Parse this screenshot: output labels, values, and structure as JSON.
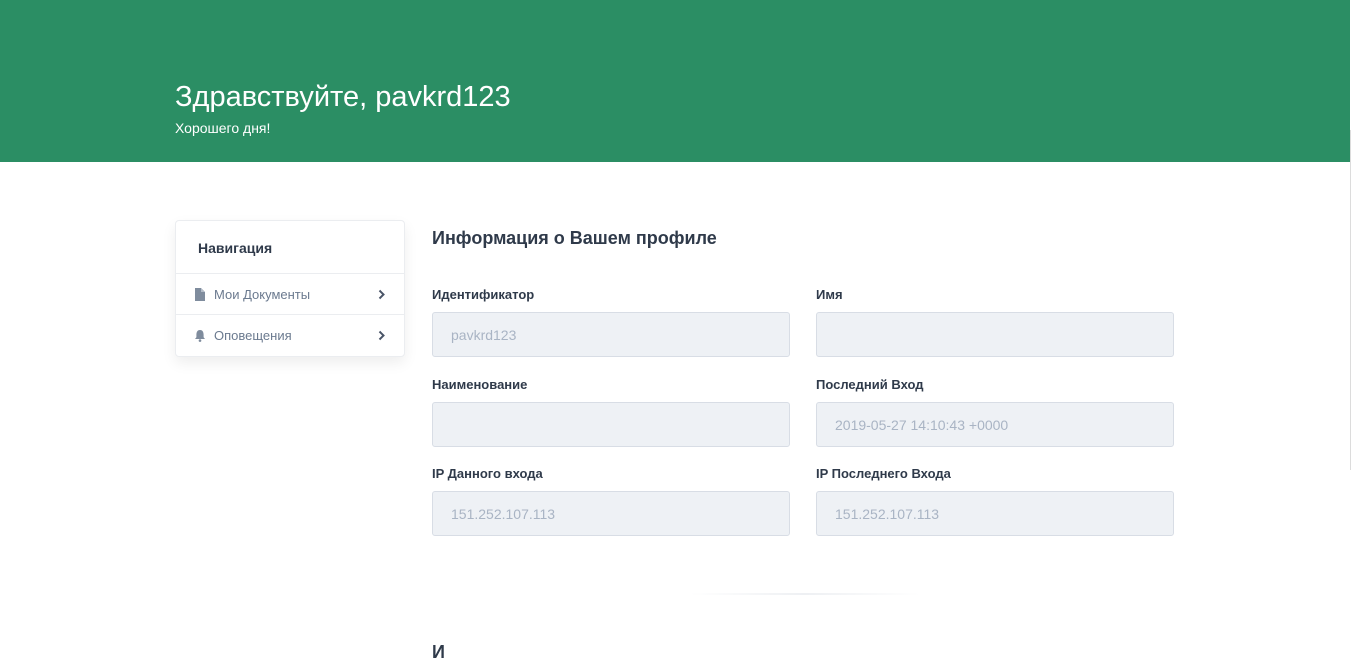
{
  "header": {
    "greeting": "Здравствуйте, pavkrd123",
    "subtitle": "Хорошего дня!",
    "background_color": "#2b8e64"
  },
  "navigation": {
    "title": "Навигация",
    "items": [
      {
        "label": "Мои Документы",
        "icon": "document-icon"
      },
      {
        "label": "Оповещения",
        "icon": "bell-icon"
      }
    ]
  },
  "profile": {
    "title": "Информация о Вашем профиле",
    "fields": {
      "identifier": {
        "label": "Идентификатор",
        "value": "pavkrd123"
      },
      "name": {
        "label": "Имя",
        "value": ""
      },
      "title_name": {
        "label": "Наименование",
        "value": ""
      },
      "last_login": {
        "label": "Последний Вход",
        "value": "2019-05-27 14:10:43 +0000"
      },
      "current_ip": {
        "label": "IP Данного входа",
        "value": "151.252.107.113"
      },
      "last_ip": {
        "label": "IP Последнего Входа",
        "value": "151.252.107.113"
      }
    }
  },
  "next_section": {
    "title": "И"
  }
}
